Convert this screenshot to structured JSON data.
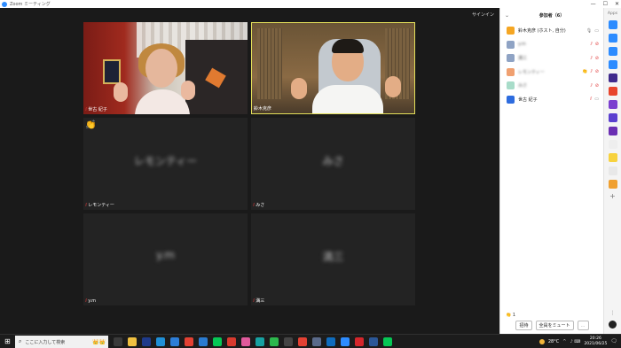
{
  "window": {
    "title": "Zoom ミーティング",
    "controls": {
      "minimize": "—",
      "maximize": "☐",
      "close": "✕"
    }
  },
  "meeting": {
    "signin_label": "サインイン",
    "tiles": [
      {
        "name": "世古 紀子",
        "video": true,
        "muted": true
      },
      {
        "name": "鈴木克彦",
        "video": true,
        "muted": false,
        "active_speaker": true
      },
      {
        "name": "レモンティー",
        "display_name": "レモンティー",
        "video": false,
        "muted": true,
        "reaction": "👏"
      },
      {
        "name": "みさ",
        "display_name": "みさ",
        "video": false,
        "muted": true
      },
      {
        "name": "y.m",
        "display_name": "y.m",
        "video": false,
        "muted": true
      },
      {
        "name": "満三",
        "display_name": "満三",
        "video": false,
        "muted": true
      }
    ]
  },
  "participants_panel": {
    "title": "参加者（6）",
    "collapse_icon": "⌄",
    "participants": [
      {
        "name": "鈴木克彦 (ホスト, 自分)",
        "avatar_color": "#f5a623",
        "mic": "on",
        "cam": "on",
        "blurred": false
      },
      {
        "name": "y.m",
        "avatar_color": "#8fa3c4",
        "mic": "off",
        "cam": "off",
        "blurred": true
      },
      {
        "name": "満三",
        "avatar_color": "#8fa3c4",
        "mic": "off",
        "cam": "off",
        "blurred": true
      },
      {
        "name": "レモンティー",
        "avatar_color": "#f0a070",
        "mic": "off",
        "cam": "off",
        "blurred": true,
        "reaction": "👏"
      },
      {
        "name": "みさ",
        "avatar_color": "#a8dcc9",
        "mic": "off",
        "cam": "off",
        "blurred": true
      },
      {
        "name": "世古 紀子",
        "avatar_color": "#2d6cdf",
        "mic": "off",
        "cam": "on",
        "blurred": false
      }
    ],
    "reaction_summary": "👏 1",
    "buttons": {
      "invite": "招待",
      "mute_all": "全員をミュート",
      "more": "…"
    }
  },
  "app_sidebar": {
    "label": "Apps",
    "apps": [
      {
        "name": "zoom-app",
        "color": "#2d8cff"
      },
      {
        "name": "music-app",
        "color": "#2d8cff"
      },
      {
        "name": "clock-app",
        "color": "#2d8cff"
      },
      {
        "name": "share-app",
        "color": "#2d8cff"
      },
      {
        "name": "slido-app",
        "color": "#3f2a8c"
      },
      {
        "name": "tab-app",
        "color": "#e8452c"
      },
      {
        "name": "whiteboard-app",
        "color": "#7b3fcf"
      },
      {
        "name": "kahoot-app",
        "color": "#5a3fcf"
      },
      {
        "name": "prezi-app",
        "color": "#6b2fb3"
      },
      {
        "name": "doc-app",
        "color": "#eeeeee"
      },
      {
        "name": "emoji-app",
        "color": "#f7d23e"
      },
      {
        "name": "games-app",
        "color": "#e8e8e8"
      },
      {
        "name": "grid-app",
        "color": "#f0a030"
      }
    ],
    "add": "+",
    "more": "⋮"
  },
  "taskbar": {
    "start_icon": "⊞",
    "search_placeholder": "ここに入力して検索",
    "search_deco": "👑👑",
    "apps": [
      {
        "name": "task-view",
        "color": "#3a3a3a"
      },
      {
        "name": "file-explorer",
        "color": "#f0c040"
      },
      {
        "name": "jp-app",
        "color": "#1e3a8a"
      },
      {
        "name": "edge-browser",
        "color": "#1f8fd6"
      },
      {
        "name": "mail-app",
        "color": "#2d7ed8"
      },
      {
        "name": "chrome-browser",
        "color": "#e34133"
      },
      {
        "name": "vscode-app",
        "color": "#2a7bd0"
      },
      {
        "name": "line-app",
        "color": "#06c755"
      },
      {
        "name": "red-app",
        "color": "#d83a2e"
      },
      {
        "name": "pink-app",
        "color": "#e05a9c"
      },
      {
        "name": "teal-app",
        "color": "#17a2a2"
      },
      {
        "name": "green-app",
        "color": "#2db84d"
      },
      {
        "name": "dark-app",
        "color": "#444444"
      },
      {
        "name": "chrome-2",
        "color": "#e34133"
      },
      {
        "name": "settings-app",
        "color": "#5a6a8a"
      },
      {
        "name": "outlook-app",
        "color": "#0f6cbd"
      },
      {
        "name": "zoom-app",
        "color": "#2d8cff"
      },
      {
        "name": "pdf-app",
        "color": "#d5262b"
      },
      {
        "name": "word-app",
        "color": "#2b5797"
      },
      {
        "name": "line-2",
        "color": "#06c755"
      }
    ],
    "temperature": "28°C",
    "tray_arrow": "^",
    "tray_misc": "♪ ⌨",
    "time": "20:26",
    "date": "2021/06/25",
    "notification": "🗨"
  }
}
